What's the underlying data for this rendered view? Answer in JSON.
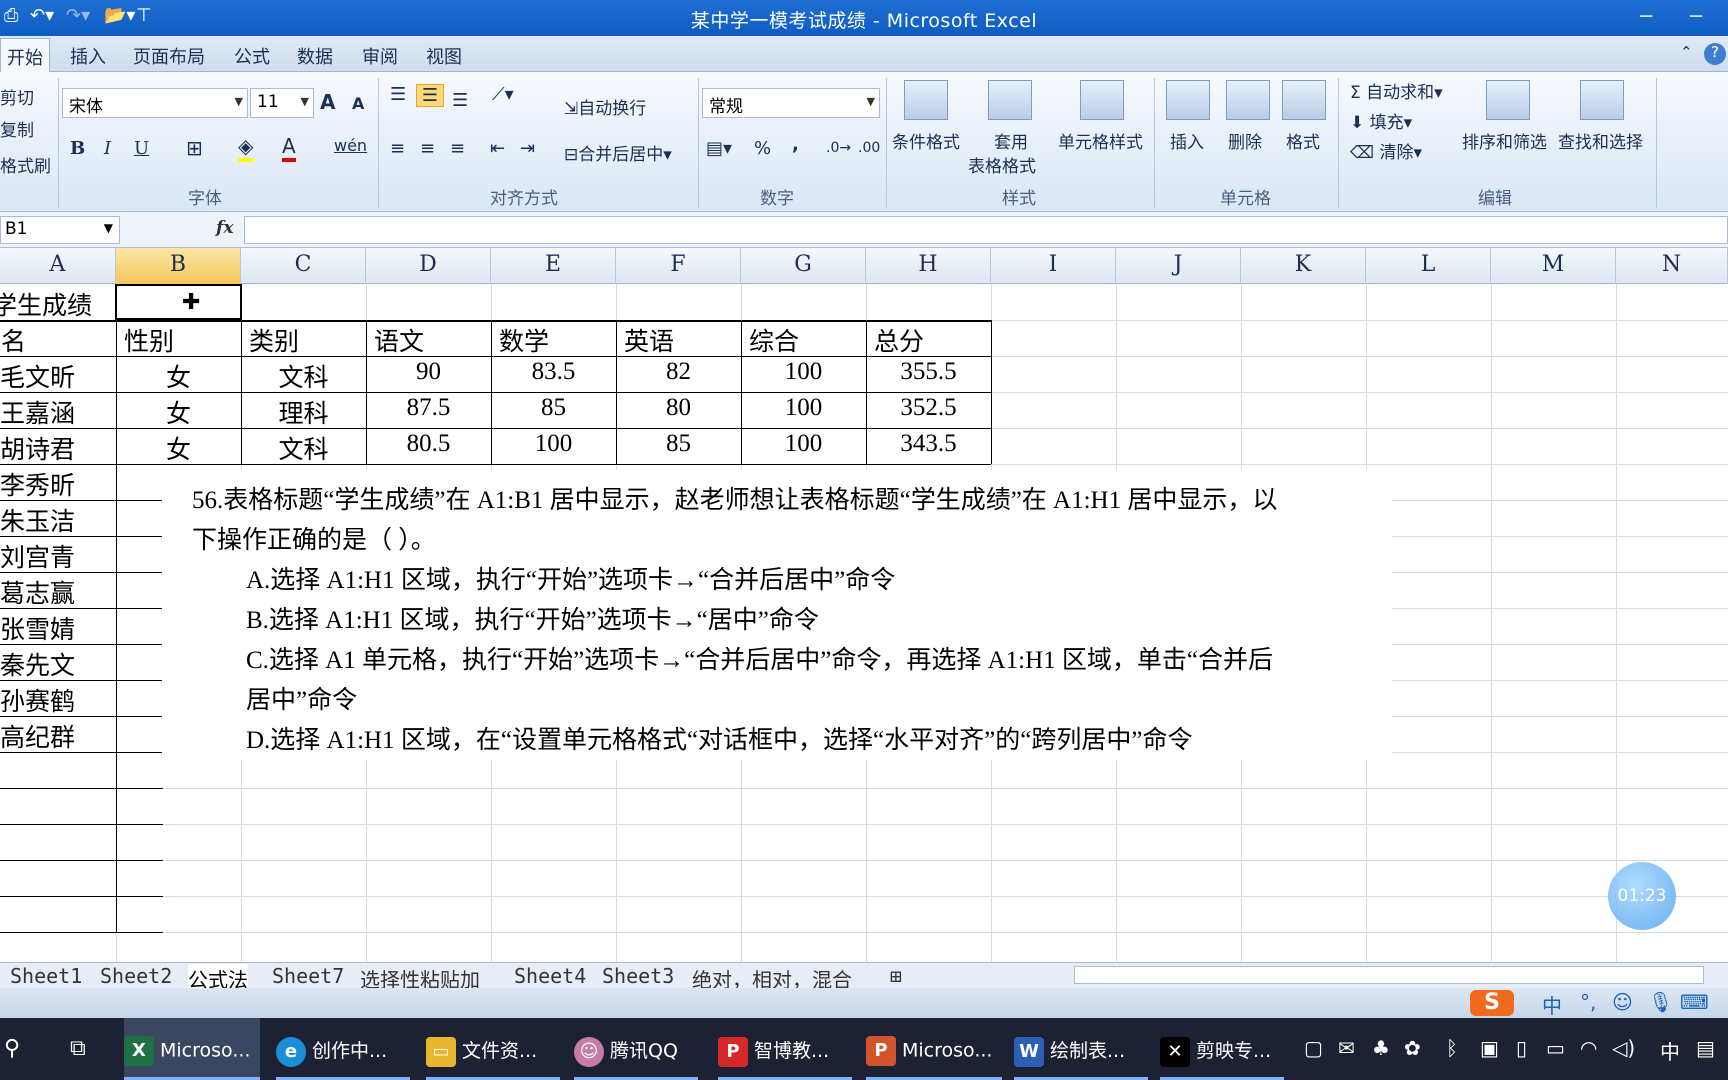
{
  "window": {
    "title": "某中学一模考试成绩 - Microsoft Excel"
  },
  "ribbon_tabs": [
    "开始",
    "插入",
    "页面布局",
    "公式",
    "数据",
    "审阅",
    "视图"
  ],
  "clipboard": {
    "cut": "剪切",
    "copy": "复制",
    "painter": "格式刷"
  },
  "font": {
    "name": "宋体",
    "size": "11",
    "group_label": "字体",
    "bold": "B",
    "italic": "I",
    "underline": "U",
    "grow": "A",
    "shrink": "A",
    "color_a": "A",
    "phonetic": "wén"
  },
  "alignment": {
    "wrap": "自动换行",
    "merge": "合并后居中",
    "group_label": "对齐方式"
  },
  "number": {
    "format": "常规",
    "percent": "%",
    "comma": ",",
    "group_label": "数字"
  },
  "styles": {
    "conditional": "条件格式",
    "table1": "套用",
    "table2": "表格格式",
    "cell_styles": "单元格样式",
    "group_label": "样式"
  },
  "cells": {
    "insert": "插入",
    "delete": "删除",
    "format": "格式",
    "group_label": "单元格"
  },
  "editing": {
    "autosum": "自动求和",
    "fill": "填充",
    "clear": "清除",
    "sort": "排序和筛选",
    "find": "查找和选择",
    "group_label": "编辑",
    "sigma": "Σ"
  },
  "formula_bar": {
    "name_box": "B1",
    "fx": "fx"
  },
  "columns": [
    "A",
    "B",
    "C",
    "D",
    "E",
    "F",
    "G",
    "H",
    "I",
    "J",
    "K",
    "L",
    "M",
    "N"
  ],
  "sheet": {
    "title": "学生成绩",
    "headers": [
      "姓名",
      "性别",
      "类别",
      "语文",
      "数学",
      "英语",
      "综合",
      "总分"
    ],
    "rows": [
      [
        "毛文昕",
        "女",
        "文科",
        "90",
        "83.5",
        "82",
        "100",
        "355.5"
      ],
      [
        "王嘉涵",
        "女",
        "理科",
        "87.5",
        "85",
        "80",
        "100",
        "352.5"
      ],
      [
        "胡诗君",
        "女",
        "文科",
        "80.5",
        "100",
        "85",
        "100",
        "343.5"
      ]
    ],
    "more_names": [
      "李秀昕",
      "朱玉洁",
      "刘宫青",
      "葛志赢",
      "张雪婧",
      "秦先文",
      "孙赛鹤",
      "高纪群"
    ]
  },
  "question": {
    "line1": "56.表格标题“学生成绩”在 A1:B1 居中显示，赵老师想让表格标题“学生成绩”在 A1:H1 居中显示，以",
    "line2": "下操作正确的是（          ）。",
    "a": "A.选择 A1:H1 区域，执行“开始”选项卡→“合并后居中”命令",
    "b": "B.选择 A1:H1 区域，执行“开始”选项卡→“居中”命令",
    "c1": "C.选择 A1 单元格，执行“开始”选项卡→“合并后居中”命令，再选择 A1:H1 区域，单击“合并后",
    "c2": "居中”命令",
    "d": "D.选择 A1:H1 区域，在“设置单元格格式“对话框中，选择“水平对齐”的“跨列居中”命令"
  },
  "sheet_tabs": [
    "Sheet1",
    "Sheet2",
    "公式法",
    "Sheet7",
    "选择性粘贴加",
    "Sheet4",
    "Sheet3",
    "绝对，相对，混合"
  ],
  "timer": "01:23",
  "taskbar": {
    "items": [
      "Microso...",
      "创作中...",
      "文件资...",
      "腾讯QQ",
      "智博教...",
      "Microso...",
      "绘制表...",
      "剪映专..."
    ],
    "ime": "中",
    "tray_lang": "中"
  }
}
